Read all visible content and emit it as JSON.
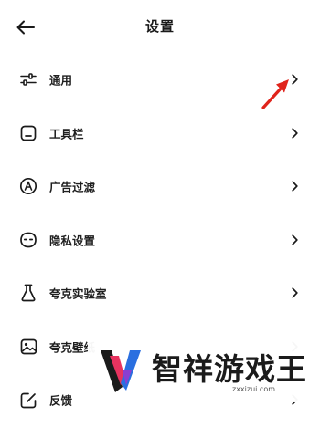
{
  "header": {
    "title": "设置"
  },
  "menu": {
    "items": [
      {
        "label": "通用",
        "icon": "sliders-icon"
      },
      {
        "label": "工具栏",
        "icon": "toolbar-icon"
      },
      {
        "label": "广告过滤",
        "icon": "ad-filter-icon"
      },
      {
        "label": "隐私设置",
        "icon": "privacy-mask-icon"
      },
      {
        "label": "夸克实验室",
        "icon": "flask-icon"
      },
      {
        "label": "夸克壁纸",
        "icon": "wallpaper-icon"
      },
      {
        "label": "反馈",
        "icon": "edit-icon"
      }
    ]
  },
  "watermark": {
    "name": "智祥游戏王",
    "url": "zxxizui.com"
  },
  "colors": {
    "annotation_arrow": "#e0241c",
    "text": "#1a1a1a",
    "background": "#ffffff"
  }
}
